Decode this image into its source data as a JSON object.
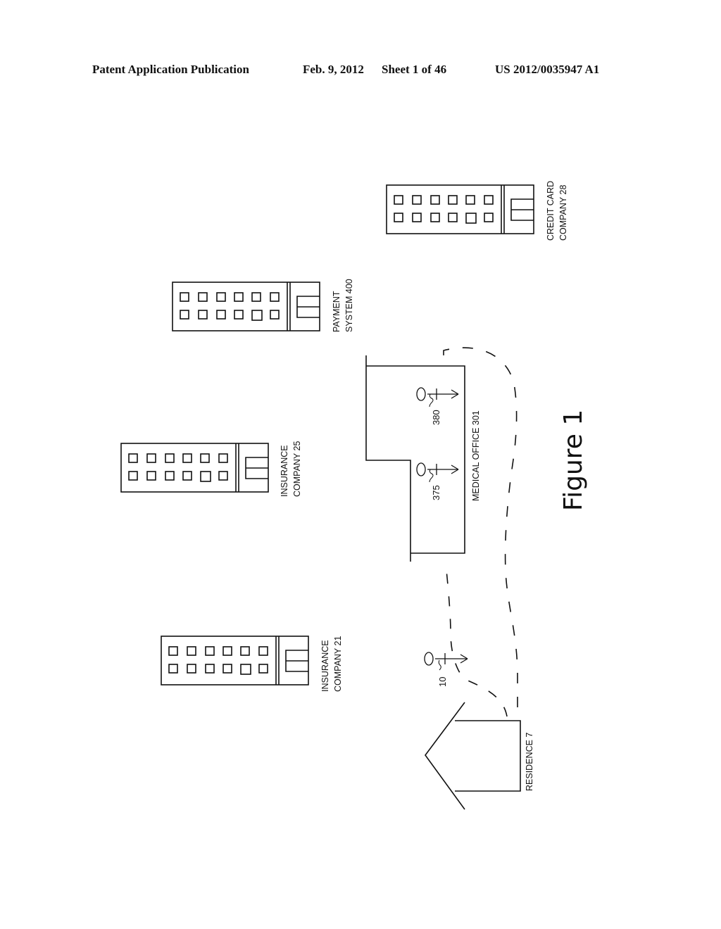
{
  "header": {
    "publication": "Patent Application Publication",
    "date": "Feb. 9, 2012",
    "sheet": "Sheet 1 of 46",
    "number": "US 2012/0035947 A1"
  },
  "figure": {
    "title": "Figure 1",
    "buildings": [
      {
        "id": "credit-card-company",
        "label_line1": "CREDIT CARD",
        "label_line2": "COMPANY 28"
      },
      {
        "id": "payment-system",
        "label_line1": "PAYMENT",
        "label_line2": "SYSTEM 400"
      },
      {
        "id": "insurance-company-25",
        "label_line1": "INSURANCE",
        "label_line2": "COMPANY 25"
      },
      {
        "id": "insurance-company-21",
        "label_line1": "INSURANCE",
        "label_line2": "COMPANY 21"
      }
    ],
    "medical_office": {
      "label": "MEDICAL OFFICE 301"
    },
    "residence": {
      "label": "RESIDENCE 7"
    },
    "persons": [
      {
        "ref": "380"
      },
      {
        "ref": "375"
      },
      {
        "ref": "10"
      }
    ]
  }
}
